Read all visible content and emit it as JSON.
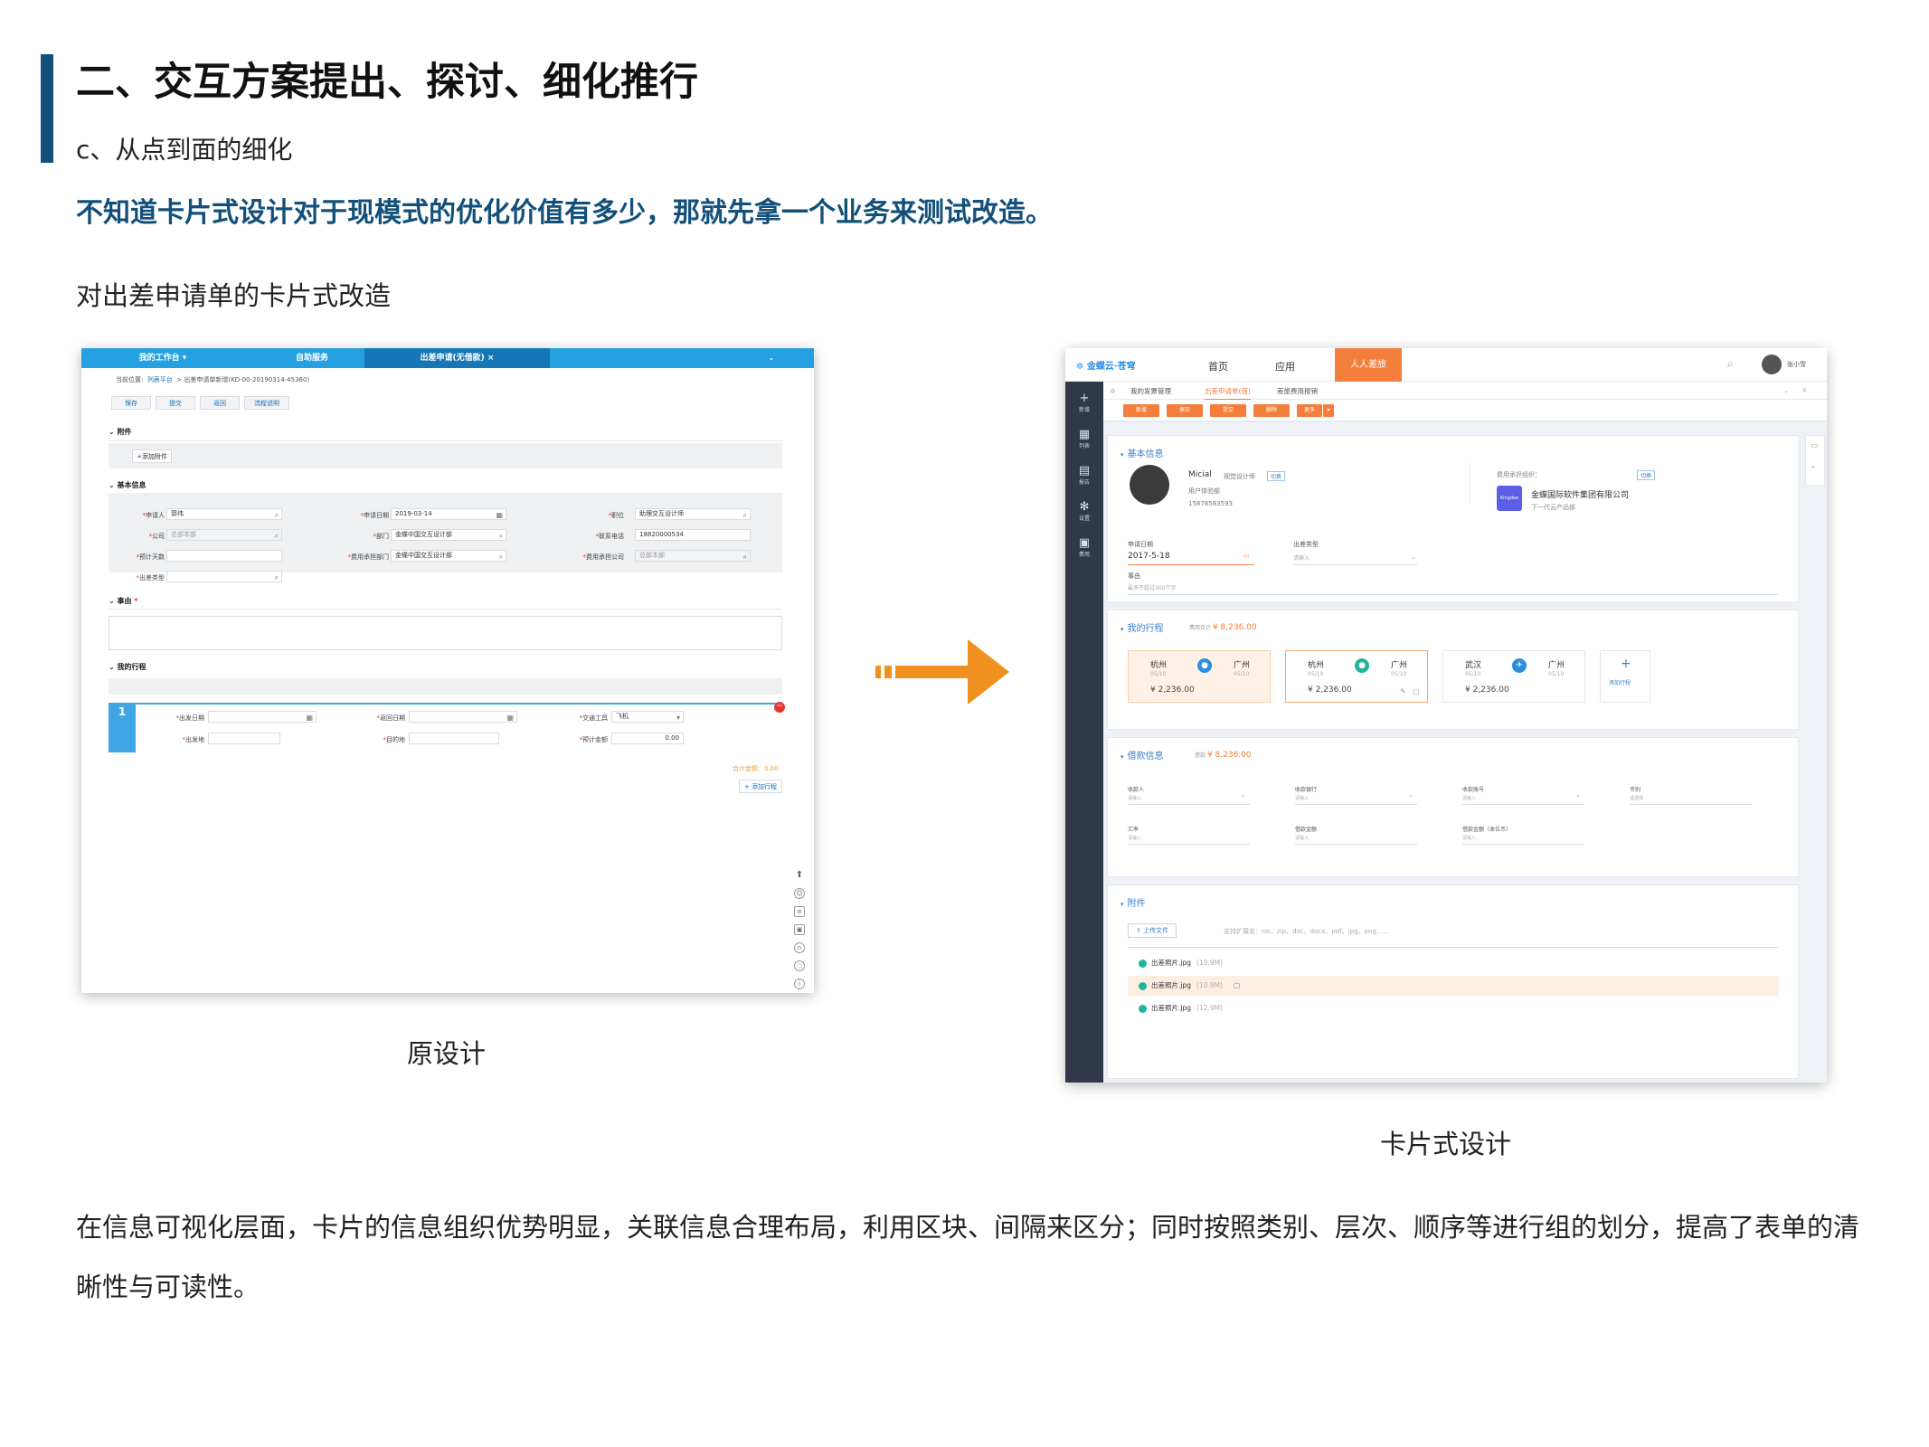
{
  "page": {
    "title": "二、交互方案提出、探讨、细化推行",
    "subtitle": "c、从点到面的细化",
    "highlight": "不知道卡片式设计对于现模式的优化价值有多少，那就先拿一个业务来测试改造。",
    "section_label": "对出差申请单的卡片式改造",
    "caption_left": "原设计",
    "caption_right": "卡片式设计",
    "paragraph_line1": "在信息可视化层面，卡片的信息组织优势明显，关联信息合理布局，利用区块、间隔来区分；同时按照类别、层次、顺序等进行组的划分，提高了表单的清",
    "paragraph_line2": "晰性与可读性。",
    "accent_color": "#12507a"
  },
  "old_ui": {
    "tabs": [
      "我的工作台",
      "自助服务",
      "出差申请(无借款)"
    ],
    "tab_close": "×",
    "breadcrumb_prefix": "当前位置:",
    "breadcrumb_link": "列表平台",
    "breadcrumb_rest": "> 出差申请单新增(KD-00-20190314-45360)",
    "buttons": [
      "保存",
      "提交",
      "返回",
      "流程说明"
    ],
    "attach_section": "附件",
    "add_attach": "+添加附件",
    "basic_section": "基本信息",
    "fields": {
      "applicant_label": "申请人",
      "applicant_value": "郭伟",
      "date_label": "申请日期",
      "date_value": "2019-03-14",
      "position_label": "职位",
      "position_value": "助理交互设计师",
      "company_label": "公司",
      "company_value": "总部本部",
      "dept_label": "部门",
      "dept_value": "金蝶中国交互设计部",
      "phone_label": "联系电话",
      "phone_value": "18820000534",
      "days_label": "预计天数",
      "cost_dept_label": "费用承担部门",
      "cost_dept_value": "金蝶中国交互设计部",
      "cost_co_label": "费用承担公司",
      "cost_co_value": "总部本部",
      "type_label": "出差类型"
    },
    "reason_section": "事由",
    "trip_section": "我的行程",
    "trip_index": "1",
    "trip_fields": {
      "depart_label": "出发日期",
      "return_label": "返回日期",
      "transport_label": "交通工具",
      "transport_value": "飞机",
      "from_label": "出发地",
      "to_label": "目的地",
      "amount_label": "预计金额",
      "amount_value": "0.00"
    },
    "total_text": "合计金额：0.00",
    "add_trip": "+ 添加行程"
  },
  "new_ui": {
    "brand": "金蝶云·苍穹",
    "nav": [
      "首页",
      "应用"
    ],
    "nav_active": "人人差旅",
    "user_name": "张小雪",
    "side_items": [
      "新增",
      "列表",
      "报告",
      "设置",
      "费用"
    ],
    "subtabs": [
      "我的发票管理",
      "出差申请单(借)",
      "差旅费用报销"
    ],
    "action_buttons": [
      "新增",
      "保存",
      "提交",
      "删除",
      "更多"
    ],
    "basic": {
      "title": "基本信息",
      "person_name": "Micial",
      "person_role": "视觉设计师",
      "switch_label": "切换",
      "person_dept": "用户体验部",
      "person_phone": "15878583593",
      "org_label": "费用承担组织：",
      "org_switch": "切换",
      "org_logo": "Kingdee",
      "org_name": "金蝶国际软件集团有限公司",
      "org_sub": "下一代云产品部",
      "date_label": "申请日期",
      "date_value": "2017-5-18",
      "trip_type_label": "出差类型",
      "trip_type_placeholder": "请输入",
      "reason_label": "事由",
      "reason_placeholder": "最多不超过300个字"
    },
    "trips": {
      "title": "我的行程",
      "total_label": "费用合计",
      "total_value": "¥ 8,236.00",
      "items": [
        {
          "from": "杭州",
          "from_date": "05/10",
          "to": "广州",
          "to_date": "05/10",
          "price": "¥ 2,236.00"
        },
        {
          "from": "杭州",
          "from_date": "05/10",
          "to": "广州",
          "to_date": "05/10",
          "price": "¥ 2,236.00"
        },
        {
          "from": "武汉",
          "from_date": "05/10",
          "to": "广州",
          "to_date": "05/10",
          "price": "¥ 2,236.00"
        }
      ],
      "add_label": "添加行程"
    },
    "loan": {
      "title": "借款信息",
      "amount_label": "借款",
      "amount_value": "¥ 8,236.00",
      "fields": [
        "收款人",
        "收款银行",
        "收款账号",
        "币别",
        "汇率",
        "借款金额",
        "借款金额（本位币）"
      ],
      "placeholder": "请输入",
      "currency_placeholder": "请选择"
    },
    "attach": {
      "title": "附件",
      "upload_label": "上传文件",
      "ext_hint": "支持扩展名：rar、zip、doc、docx、pdf、jpg、png……",
      "files": [
        {
          "name": "出差照片.jpg",
          "size": "(10.9M)"
        },
        {
          "name": "出差照片.jpg",
          "size": "(10.9M)"
        },
        {
          "name": "出差照片.jpg",
          "size": "(12.9M)"
        }
      ]
    }
  }
}
